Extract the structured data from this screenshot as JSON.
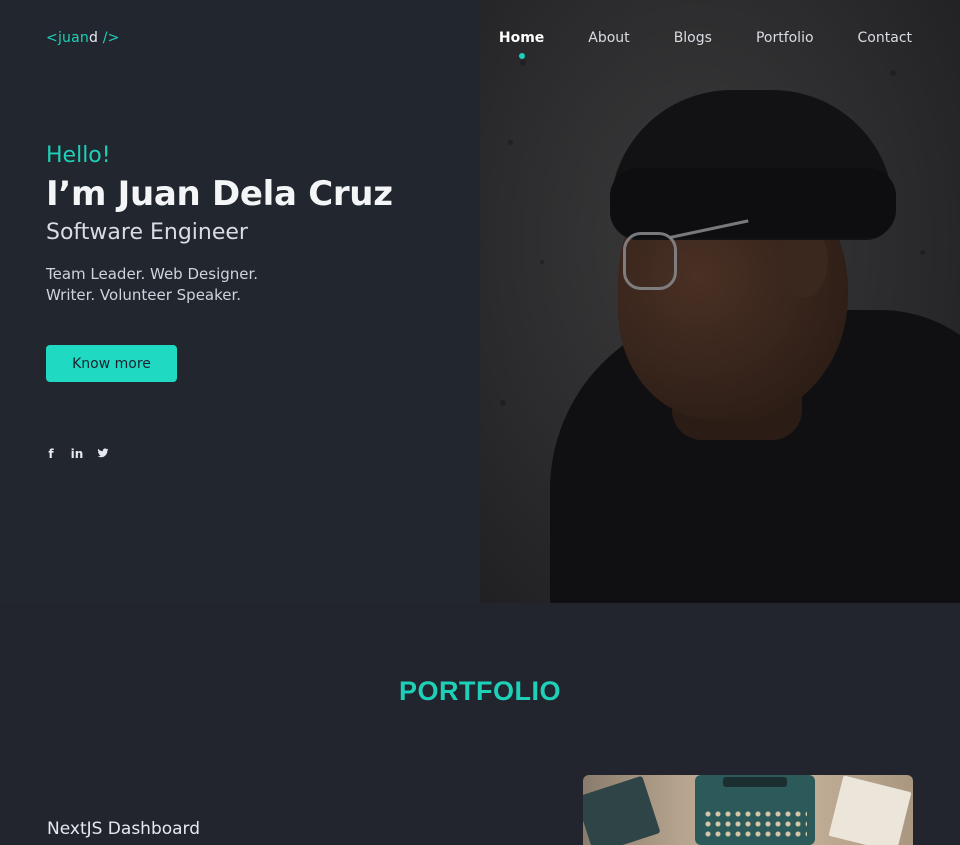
{
  "brand": {
    "logo_open": "<",
    "logo_name_a": "juan",
    "logo_name_b": "d",
    "logo_close": " />"
  },
  "nav": {
    "items": [
      "Home",
      "About",
      "Blogs",
      "Portfolio",
      "Contact"
    ],
    "active": "Home"
  },
  "hero": {
    "greeting": "Hello!",
    "name": "I’m Juan Dela Cruz",
    "role": "Software Engineer",
    "tagline_line1": "Team Leader. Web Designer.",
    "tagline_line2": "Writer. Volunteer Speaker.",
    "cta_label": "Know more",
    "social": [
      {
        "icon": "facebook-icon",
        "glyph": "f"
      },
      {
        "icon": "linkedin-icon",
        "glyph": "in"
      },
      {
        "icon": "twitter-icon",
        "glyph": "🐦"
      }
    ]
  },
  "portfolio": {
    "heading": "PORTFOLIO",
    "project_title": "NextJS Dashboard"
  },
  "colors": {
    "accent": "#1fd0b9",
    "background": "#22262f",
    "button": "#1fd9c2"
  }
}
